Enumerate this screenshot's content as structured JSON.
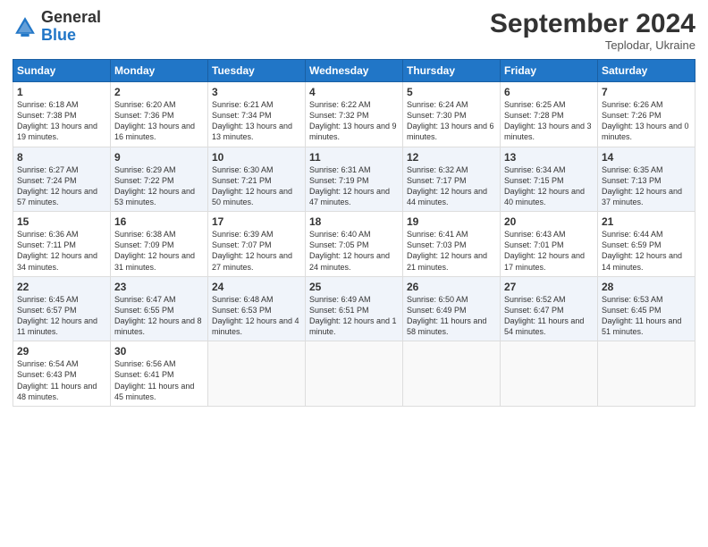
{
  "header": {
    "logo_general": "General",
    "logo_blue": "Blue",
    "month_title": "September 2024",
    "location": "Teplodar, Ukraine"
  },
  "days_of_week": [
    "Sunday",
    "Monday",
    "Tuesday",
    "Wednesday",
    "Thursday",
    "Friday",
    "Saturday"
  ],
  "weeks": [
    [
      {
        "day": 1,
        "sunrise": "6:18 AM",
        "sunset": "7:38 PM",
        "daylight": "13 hours and 19 minutes."
      },
      {
        "day": 2,
        "sunrise": "6:20 AM",
        "sunset": "7:36 PM",
        "daylight": "13 hours and 16 minutes."
      },
      {
        "day": 3,
        "sunrise": "6:21 AM",
        "sunset": "7:34 PM",
        "daylight": "13 hours and 13 minutes."
      },
      {
        "day": 4,
        "sunrise": "6:22 AM",
        "sunset": "7:32 PM",
        "daylight": "13 hours and 9 minutes."
      },
      {
        "day": 5,
        "sunrise": "6:24 AM",
        "sunset": "7:30 PM",
        "daylight": "13 hours and 6 minutes."
      },
      {
        "day": 6,
        "sunrise": "6:25 AM",
        "sunset": "7:28 PM",
        "daylight": "13 hours and 3 minutes."
      },
      {
        "day": 7,
        "sunrise": "6:26 AM",
        "sunset": "7:26 PM",
        "daylight": "13 hours and 0 minutes."
      }
    ],
    [
      {
        "day": 8,
        "sunrise": "6:27 AM",
        "sunset": "7:24 PM",
        "daylight": "12 hours and 57 minutes."
      },
      {
        "day": 9,
        "sunrise": "6:29 AM",
        "sunset": "7:22 PM",
        "daylight": "12 hours and 53 minutes."
      },
      {
        "day": 10,
        "sunrise": "6:30 AM",
        "sunset": "7:21 PM",
        "daylight": "12 hours and 50 minutes."
      },
      {
        "day": 11,
        "sunrise": "6:31 AM",
        "sunset": "7:19 PM",
        "daylight": "12 hours and 47 minutes."
      },
      {
        "day": 12,
        "sunrise": "6:32 AM",
        "sunset": "7:17 PM",
        "daylight": "12 hours and 44 minutes."
      },
      {
        "day": 13,
        "sunrise": "6:34 AM",
        "sunset": "7:15 PM",
        "daylight": "12 hours and 40 minutes."
      },
      {
        "day": 14,
        "sunrise": "6:35 AM",
        "sunset": "7:13 PM",
        "daylight": "12 hours and 37 minutes."
      }
    ],
    [
      {
        "day": 15,
        "sunrise": "6:36 AM",
        "sunset": "7:11 PM",
        "daylight": "12 hours and 34 minutes."
      },
      {
        "day": 16,
        "sunrise": "6:38 AM",
        "sunset": "7:09 PM",
        "daylight": "12 hours and 31 minutes."
      },
      {
        "day": 17,
        "sunrise": "6:39 AM",
        "sunset": "7:07 PM",
        "daylight": "12 hours and 27 minutes."
      },
      {
        "day": 18,
        "sunrise": "6:40 AM",
        "sunset": "7:05 PM",
        "daylight": "12 hours and 24 minutes."
      },
      {
        "day": 19,
        "sunrise": "6:41 AM",
        "sunset": "7:03 PM",
        "daylight": "12 hours and 21 minutes."
      },
      {
        "day": 20,
        "sunrise": "6:43 AM",
        "sunset": "7:01 PM",
        "daylight": "12 hours and 17 minutes."
      },
      {
        "day": 21,
        "sunrise": "6:44 AM",
        "sunset": "6:59 PM",
        "daylight": "12 hours and 14 minutes."
      }
    ],
    [
      {
        "day": 22,
        "sunrise": "6:45 AM",
        "sunset": "6:57 PM",
        "daylight": "12 hours and 11 minutes."
      },
      {
        "day": 23,
        "sunrise": "6:47 AM",
        "sunset": "6:55 PM",
        "daylight": "12 hours and 8 minutes."
      },
      {
        "day": 24,
        "sunrise": "6:48 AM",
        "sunset": "6:53 PM",
        "daylight": "12 hours and 4 minutes."
      },
      {
        "day": 25,
        "sunrise": "6:49 AM",
        "sunset": "6:51 PM",
        "daylight": "12 hours and 1 minute."
      },
      {
        "day": 26,
        "sunrise": "6:50 AM",
        "sunset": "6:49 PM",
        "daylight": "11 hours and 58 minutes."
      },
      {
        "day": 27,
        "sunrise": "6:52 AM",
        "sunset": "6:47 PM",
        "daylight": "11 hours and 54 minutes."
      },
      {
        "day": 28,
        "sunrise": "6:53 AM",
        "sunset": "6:45 PM",
        "daylight": "11 hours and 51 minutes."
      }
    ],
    [
      {
        "day": 29,
        "sunrise": "6:54 AM",
        "sunset": "6:43 PM",
        "daylight": "11 hours and 48 minutes."
      },
      {
        "day": 30,
        "sunrise": "6:56 AM",
        "sunset": "6:41 PM",
        "daylight": "11 hours and 45 minutes."
      },
      null,
      null,
      null,
      null,
      null
    ]
  ]
}
